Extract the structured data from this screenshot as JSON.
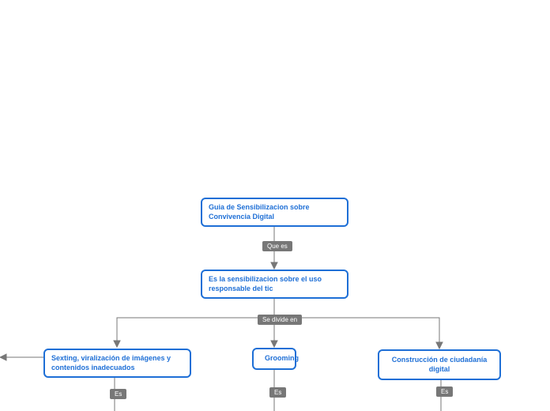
{
  "nodes": {
    "root": {
      "text": "Guia de Sensibilizacion sobre Convivencia Digital"
    },
    "definition": {
      "text": "Es la sensibilizacion sobre el uso responsable del tic"
    },
    "sexting": {
      "text": "Sexting, viralización de imágenes y contenidos inadecuados"
    },
    "grooming": {
      "text": "Grooming"
    },
    "ciudadania": {
      "text": "Construcción de ciudadanía digital"
    }
  },
  "edges": {
    "que_es": {
      "label": "Que es"
    },
    "se_divide_en": {
      "label": "Se divide en"
    },
    "es1": {
      "label": "Es"
    },
    "es2": {
      "label": "Es"
    },
    "es3": {
      "label": "Es"
    }
  }
}
